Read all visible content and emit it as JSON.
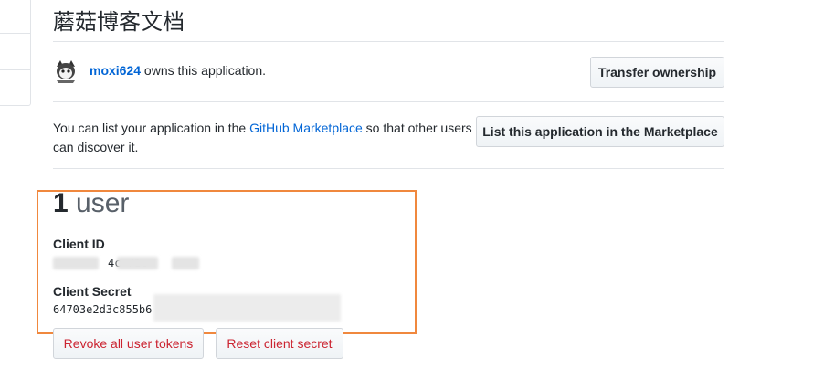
{
  "app": {
    "title": "蘑菇博客文档"
  },
  "owner": {
    "username": "moxi624",
    "suffix": " owns this application.",
    "transfer_label": "Transfer ownership"
  },
  "marketplace": {
    "text_before": "You can list your application in the ",
    "link_label": "GitHub Marketplace",
    "text_after": " so that other users can discover it.",
    "button_label": "List this application in the Marketplace"
  },
  "users": {
    "count": "1",
    "unit": "user"
  },
  "client_id": {
    "label": "Client ID",
    "value_visible": "4c        71c"
  },
  "client_secret": {
    "label": "Client Secret",
    "value_visible": "64703e2d3c855b6"
  },
  "actions": {
    "revoke_label": "Revoke all user tokens",
    "reset_label": "Reset client secret"
  },
  "colors": {
    "link": "#0366d6",
    "danger": "#cb2431",
    "highlight": "#f0883e",
    "border": "#e1e4e8"
  }
}
